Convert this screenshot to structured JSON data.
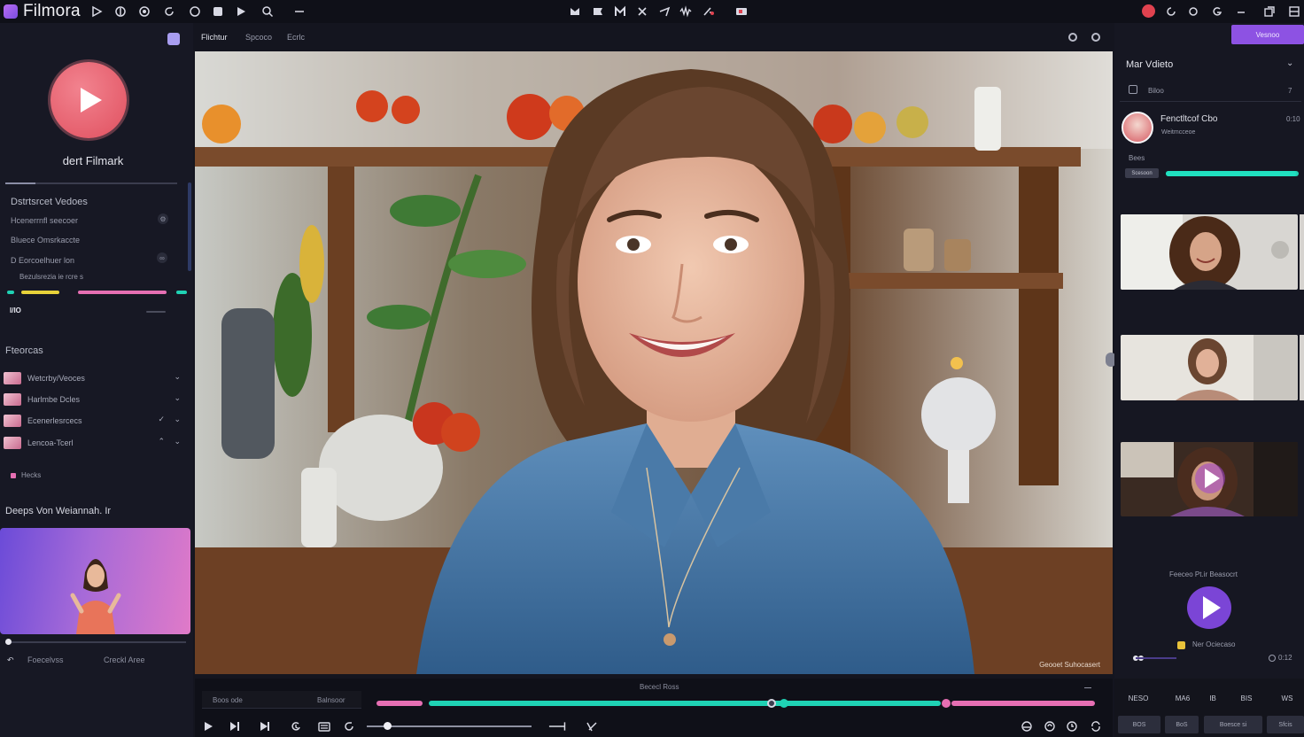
{
  "app": {
    "name": "Filmora"
  },
  "colors": {
    "accent": "#8d52e3",
    "teal": "#1fd2b4",
    "pink": "#e66fb3",
    "record": "#e0424f"
  },
  "toolbar": {
    "left_icons": [
      "play-icon",
      "layers-icon",
      "undo-icon",
      "redo-icon",
      "circle-icon",
      "media-icon",
      "play-filled-icon",
      "search-icon",
      "minus-icon"
    ],
    "center_icons": [
      "split-icon",
      "flag-icon",
      "marker-icon",
      "scissors-icon",
      "arrow-icon",
      "audio-icon",
      "pen-icon",
      "screen-icon"
    ],
    "right_icons": [
      "record-icon",
      "refresh-icon",
      "sync-icon",
      "share-icon",
      "minimize-icon",
      "restore-icon",
      "close-icon"
    ]
  },
  "sidebar": {
    "brand": "dert Filmark",
    "featured_heading": "Dstrtsrcet Vedoes",
    "rows": [
      "Hcenerrnfl seecoer",
      "Bluece Omsrkaccte",
      "D Eorcoelhuer lon",
      "Bezulsrezia ie rcre s"
    ],
    "tag": "I/IO",
    "favorites_heading": "Fteorcas",
    "favorites": [
      "Wetcrby/Veoces",
      "Harlmbe Dcles",
      "Ecenerlesrcecs",
      "Lencoa-Tcerl"
    ],
    "favorites_footer": "Hecks",
    "promo_heading": "Deeps Von Weiannah. Ir",
    "footer": {
      "left": "Foecelvss",
      "right": "Creckl Aree"
    }
  },
  "viewbar": {
    "tabs": [
      "Flichtur",
      "Spcoco",
      "Ecrlc"
    ]
  },
  "preview": {
    "caption": "Geooet Suhocasert"
  },
  "right_panel": {
    "button": "Vesnoo",
    "title": "Mar Vdieto",
    "sub_label": "Biloo",
    "sub_index": "7",
    "creator_name": "Fenctltcof Cbo",
    "creator_meta": "Weitmcceoe",
    "creator_time": "0:10",
    "progress_label": "Bees",
    "chip": "Scesoon",
    "progress": 0.98,
    "promo_caption": "Feeceo Pt.ir Beasocrt",
    "mini_label": "Ner Ociecaso",
    "mini_time": "0:12"
  },
  "timeline": {
    "left_labels": [
      "Boos ode",
      "Balnsoor"
    ],
    "center_label": "Bececl   Ross",
    "playhead": 0.67
  },
  "bottom_right": {
    "cells": [
      "NESO",
      "MA6",
      "IB",
      "BIS",
      "WS"
    ],
    "buttons": [
      "BOS",
      "BoS",
      "Boesce si",
      "Sfcis"
    ]
  }
}
